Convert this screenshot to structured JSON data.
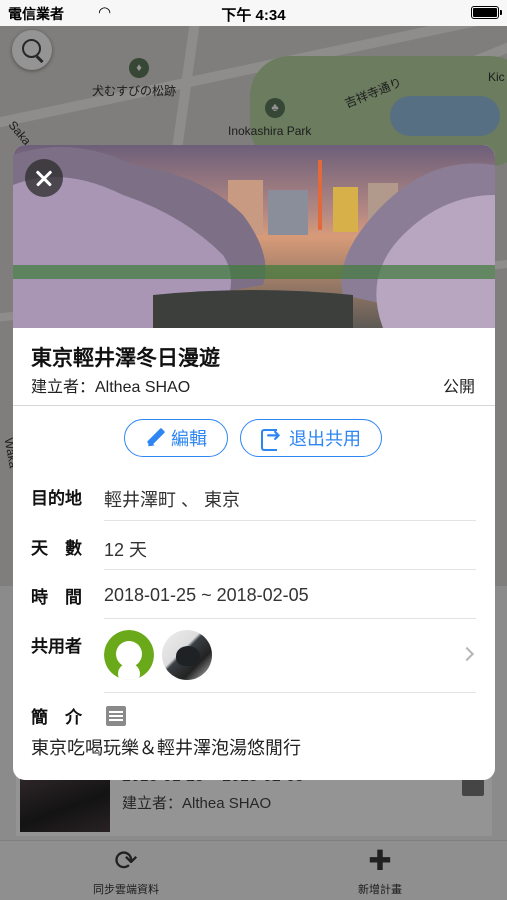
{
  "status_bar": {
    "carrier": "電信業者",
    "time": "下午 4:34"
  },
  "map": {
    "labels": [
      "犬むすびの松跡",
      "Inokashira Park",
      "吉祥寺通り",
      "Saka",
      "Waka",
      "Kic"
    ]
  },
  "background_trip": {
    "dates": "2018-01-25 ~ 2018-02-05",
    "creator": "建立者：Althea SHAO"
  },
  "tab_bar": {
    "sync_label": "同步雲端資料",
    "add_label": "新增計畫"
  },
  "modal": {
    "title": "東京輕井澤冬日漫遊",
    "creator": "建立者：Althea SHAO",
    "visibility": "公開",
    "edit_label": "編輯",
    "leave_label": "退出共用",
    "destination_key": "目的地",
    "destination_value": "輕井澤町 、 東京",
    "days_key": "天　數",
    "days_value": "12 天",
    "time_key": "時　間",
    "time_value": "2018-01-25 ~ 2018-02-05",
    "sharers_key": "共用者",
    "intro_key": "簡　介",
    "intro_text": "東京吃喝玩樂＆輕井澤泡湯悠閒行"
  },
  "colors": {
    "accent": "#2e86f4",
    "avatar_green": "#6aaa1a"
  },
  "icons": [
    "search-icon",
    "close-icon",
    "pencil-icon",
    "exit-icon",
    "chevron-right-icon",
    "note-icon",
    "sync-icon",
    "plus-icon",
    "wifi-icon",
    "battery-icon"
  ]
}
